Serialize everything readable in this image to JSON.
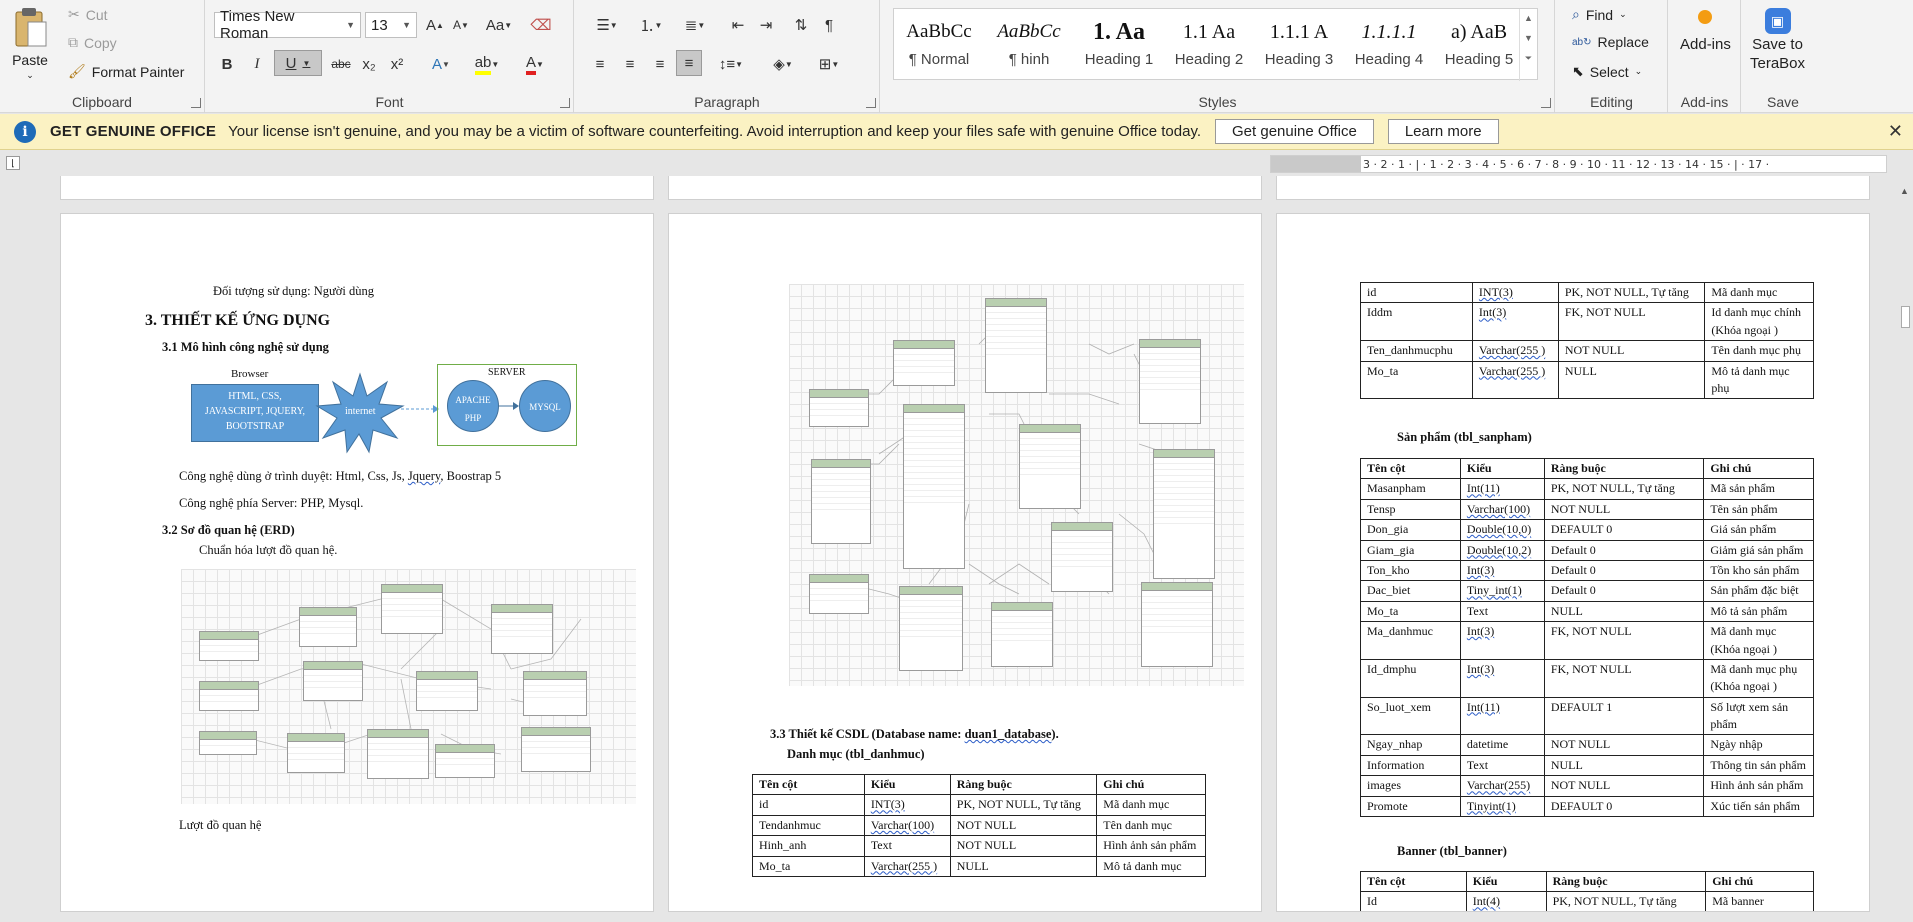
{
  "clipboard": {
    "paste": "Paste",
    "cut": "Cut",
    "copy": "Copy",
    "format_painter": "Format Painter",
    "label": "Clipboard"
  },
  "font": {
    "name": "Times New Roman",
    "size": "13",
    "label": "Font",
    "bold": "B",
    "italic": "I",
    "underline": "U",
    "strike": "abc",
    "subscript": "x₂",
    "superscript": "x²",
    "grow": "A",
    "shrink": "A",
    "case": "Aa"
  },
  "paragraph": {
    "label": "Paragraph"
  },
  "styles": {
    "label": "Styles",
    "items": [
      {
        "preview": "AaBbCc",
        "name": "¶ Normal"
      },
      {
        "preview": "AaBbCc",
        "name": "¶ hinh"
      },
      {
        "preview": "1. Aa",
        "name": "Heading 1"
      },
      {
        "preview": "1.1 Aa",
        "name": "Heading 2"
      },
      {
        "preview": "1.1.1 A",
        "name": "Heading 3"
      },
      {
        "preview": "1.1.1.1",
        "name": "Heading 4"
      },
      {
        "preview": "a) AaB",
        "name": "Heading 5"
      }
    ]
  },
  "editing": {
    "label": "Editing",
    "find": "Find",
    "replace": "Replace",
    "select": "Select"
  },
  "addins": {
    "label": "Add-ins",
    "button": "Add-ins"
  },
  "save": {
    "label": "Save",
    "button_line1": "Save to",
    "button_line2": "TeraBox"
  },
  "infobar": {
    "title": "GET GENUINE OFFICE",
    "message": "Your license isn't genuine, and you may be a victim of software counterfeiting. Avoid interruption and keep your files safe with genuine Office today.",
    "btn_genuine": "Get genuine Office",
    "btn_learn": "Learn more"
  },
  "ruler": {
    "ticks": "3 · 2 · 1 · | · 1 · 2 · 3 · 4 · 5 · 6 · 7 · 8 · 9 · 10 · 11 · 12 · 13 · 14 · 15 · | · 17 ·"
  },
  "page1": {
    "doi_tuong": "Đối tượng sử dụng: Người dùng",
    "h_3": "3. THIẾT KẾ ỨNG DỤNG",
    "h_31": "3.1 Mô hình công nghệ sử dụng",
    "browser_label": "Browser",
    "browser_box": "HTML, CSS, JAVASCRIPT, JQUERY, BOOTSTRAP",
    "internet": "internet",
    "server_label": "SERVER",
    "apache": "APACHE PHP",
    "mysql": "MYSQL",
    "cn_browser_pre": "Công nghệ dùng ở trình duyệt: Html, Css, Js, ",
    "cn_browser_jq": "Jquery",
    "cn_browser_post": ", Boostrap 5",
    "cn_server": "Công nghệ phía Server: PHP, Mysql.",
    "h_32": "3.2 Sơ đồ quan hệ (ERD)",
    "chuan_hoa": "Chuẩn hóa lượt đồ quan hệ.",
    "caption": "Lượt đồ quan hệ"
  },
  "page2": {
    "h_33_pre": "3.3 Thiết kế CSDL (Database name: ",
    "h_33_db": "duan1_database",
    "h_33_post": ").",
    "danh_muc": "Danh mục (tbl_danhmuc)",
    "table": {
      "headers": [
        "Tên cột",
        "Kiểu",
        "Ràng buộc",
        "Ghi chú"
      ],
      "rows": [
        [
          "id",
          "INT(3)",
          "PK, NOT NULL, Tự tăng",
          "Mã danh mục"
        ],
        [
          "Tendanhmuc",
          "Varchar(100)",
          "NOT NULL",
          "Tên danh mục"
        ],
        [
          "Hinh_anh",
          "Text",
          "NOT NULL",
          "Hình ảnh sản phẩm"
        ],
        [
          "Mo_ta",
          "Varchar(255 )",
          "NULL",
          "Mô tả danh mục"
        ]
      ]
    }
  },
  "page3": {
    "dmphu_rows": [
      [
        "id",
        "INT(3)",
        "PK, NOT NULL, Tự tăng",
        "Mã danh mục"
      ],
      [
        "Iddm",
        "Int(3)",
        "FK, NOT NULL",
        "Id danh mục chính (Khóa ngoại )"
      ],
      [
        "Ten_danhmucphu",
        "Varchar(255 )",
        "NOT NULL",
        "Tên danh mục phụ"
      ],
      [
        "Mo_ta",
        "Varchar(255 )",
        "NULL",
        "Mô tả danh mục phụ"
      ]
    ],
    "san_pham_title": "Sản phẩm (tbl_sanpham)",
    "sanpham": {
      "headers": [
        "Tên cột",
        "Kiểu",
        "Ràng buộc",
        "Ghi chú"
      ],
      "rows": [
        [
          "Masanpham",
          "Int(11)",
          "PK, NOT NULL, Tự tăng",
          "Mã sản phẩm"
        ],
        [
          "Tensp",
          "Varchar(100)",
          "NOT NULL",
          "Tên sản phẩm"
        ],
        [
          "Don_gia",
          "Double(10,0)",
          "DEFAULT 0",
          "Giá sản phẩm"
        ],
        [
          "Giam_gia",
          "Double(10,2)",
          "Default 0",
          "Giảm giá sản phẩm"
        ],
        [
          "Ton_kho",
          "Int(3)",
          "Default 0",
          "Tồn kho sản phẩm"
        ],
        [
          "Dac_biet",
          "Tiny_int(1)",
          "Default 0",
          "Sản phẩm đặc biệt"
        ],
        [
          "Mo_ta",
          "Text",
          "NULL",
          "Mô tả sản phẩm"
        ],
        [
          "Ma_danhmuc",
          "Int(3)",
          "FK, NOT NULL",
          "Mã danh mục (Khóa ngoại )"
        ],
        [
          "Id_dmphu",
          "Int(3)",
          "FK, NOT NULL",
          "Mã danh mục phụ (Khóa ngoại )"
        ],
        [
          "So_luot_xem",
          "Int(11)",
          "DEFAULT 1",
          "Số lượt xem sản phẩm"
        ],
        [
          "Ngay_nhap",
          "datetime",
          "NOT NULL",
          "Ngày nhập"
        ],
        [
          "Information",
          "Text",
          "NULL",
          "Thông tin sản phẩm"
        ],
        [
          "images",
          "Varchar(255)",
          "NOT NULL",
          "Hình ảnh sản phẩm"
        ],
        [
          "Promote",
          "Tinyint(1)",
          "DEFAULT 0",
          "Xúc tiến sản phẩm"
        ]
      ]
    },
    "banner_title": "Banner (tbl_banner)",
    "banner": {
      "headers": [
        "Tên cột",
        "Kiểu",
        "Ràng buộc",
        "Ghi chú"
      ],
      "rows": [
        [
          "Id",
          "Int(4)",
          "PK, NOT NULL, Tự tăng",
          "Mã banner"
        ]
      ]
    }
  },
  "colors": {
    "accent": "#2b579a",
    "infobar": "#fbf2c3",
    "diagram_blue": "#5b9bd5",
    "erd_header": "#b9cfb0"
  }
}
